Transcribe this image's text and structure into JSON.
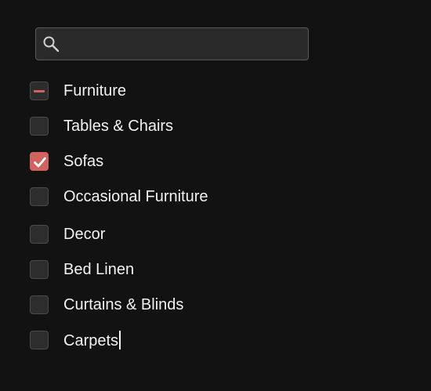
{
  "search": {
    "value": "",
    "placeholder": "",
    "icon": "search-icon"
  },
  "colors": {
    "accent": "#d0635d",
    "background": "#121212",
    "checkbox_bg": "#2d2d2d"
  },
  "categories": [
    {
      "label": "Furniture",
      "state": "indeterminate"
    },
    {
      "label": "Tables & Chairs",
      "state": "unchecked"
    },
    {
      "label": "Sofas",
      "state": "checked"
    },
    {
      "label": "Occasional Furniture",
      "state": "unchecked"
    },
    {
      "label": "Decor",
      "state": "unchecked"
    },
    {
      "label": "Bed Linen",
      "state": "unchecked"
    },
    {
      "label": "Curtains & Blinds",
      "state": "unchecked"
    },
    {
      "label": "Carpets",
      "state": "unchecked"
    }
  ]
}
